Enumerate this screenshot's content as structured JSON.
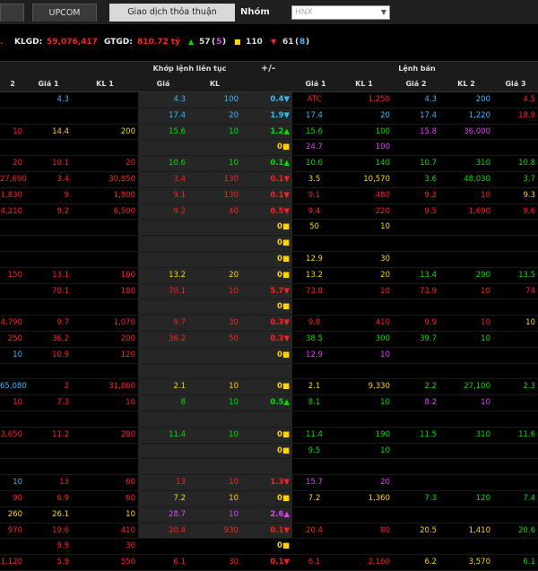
{
  "tabs": {
    "first": "",
    "upcom": "UPCOM",
    "thoathuan": "Giao dịch thỏa thuận"
  },
  "nhom_label": "Nhóm",
  "select_value": "HNX",
  "stats": {
    "klgd_label": "KLGD:",
    "klgd_value": "59,076,417",
    "gtgd_label": "GTGD:",
    "gtgd_value": "810.72 tỷ",
    "up_arrow": "▲",
    "up_count": "57",
    "up_ceil": "5",
    "ref_icon": "■",
    "ref_count": "110",
    "down_arrow": "▼",
    "down_count": "61",
    "down_floor": "8",
    "colors": {
      "up": "#00e000",
      "ref": "#ffd400",
      "down": "#ff2020",
      "ceil": "#e040fb",
      "floor": "#33bbff"
    }
  },
  "headers": {
    "match_group": "Khớp lệnh liên tục",
    "change": "+/-",
    "sell_group": "Lệnh bán",
    "cols": [
      "2",
      "Giá 1",
      "KL 1",
      "Giá",
      "KL",
      "",
      "Giá 1",
      "KL 1",
      "Giá 2",
      "KL 2",
      "Giá 3"
    ]
  },
  "rows": [
    [
      [
        "",
        ""
      ],
      [
        "4.3",
        "f"
      ],
      [
        "",
        ""
      ],
      [
        "4.3",
        "f"
      ],
      [
        "100",
        "f"
      ],
      [
        "0.4▼",
        "f"
      ],
      [
        "ATC",
        "d"
      ],
      [
        "1,250",
        "d"
      ],
      [
        "4.3",
        "f"
      ],
      [
        "200",
        "f"
      ],
      [
        "4.5",
        "d"
      ]
    ],
    [
      [
        "",
        ""
      ],
      [
        "",
        ""
      ],
      [
        "",
        ""
      ],
      [
        "17.4",
        "f"
      ],
      [
        "20",
        "f"
      ],
      [
        "1.9▼",
        "f"
      ],
      [
        "17.4",
        "f"
      ],
      [
        "20",
        "f"
      ],
      [
        "17.4",
        "f"
      ],
      [
        "1,220",
        "f"
      ],
      [
        "18.9",
        "d"
      ]
    ],
    [
      [
        "10",
        "d"
      ],
      [
        "14.4",
        "r"
      ],
      [
        "200",
        "r"
      ],
      [
        "15.6",
        "u"
      ],
      [
        "10",
        "u"
      ],
      [
        "1.2▲",
        "u"
      ],
      [
        "15.6",
        "u"
      ],
      [
        "100",
        "u"
      ],
      [
        "15.8",
        "c"
      ],
      [
        "36,000",
        "c"
      ],
      [
        "",
        ""
      ]
    ],
    [
      [
        "",
        ""
      ],
      [
        "",
        ""
      ],
      [
        "",
        ""
      ],
      [
        "",
        ""
      ],
      [
        "",
        ""
      ],
      [
        "0■",
        "r"
      ],
      [
        "24.7",
        "c"
      ],
      [
        "100",
        "c"
      ],
      [
        "",
        ""
      ],
      [
        "",
        ""
      ],
      [
        "",
        ""
      ]
    ],
    [
      [
        "20",
        "d"
      ],
      [
        "10.1",
        "d"
      ],
      [
        "20",
        "d"
      ],
      [
        "10.6",
        "u"
      ],
      [
        "10",
        "u"
      ],
      [
        "0.1▲",
        "u"
      ],
      [
        "10.6",
        "u"
      ],
      [
        "140",
        "u"
      ],
      [
        "10.7",
        "u"
      ],
      [
        "310",
        "u"
      ],
      [
        "10.8",
        "u"
      ]
    ],
    [
      [
        "27,690",
        "d"
      ],
      [
        "3.4",
        "d"
      ],
      [
        "30,850",
        "d"
      ],
      [
        "3.4",
        "d"
      ],
      [
        "130",
        "d"
      ],
      [
        "0.1▼",
        "d"
      ],
      [
        "3.5",
        "r"
      ],
      [
        "10,570",
        "r"
      ],
      [
        "3.6",
        "u"
      ],
      [
        "48,030",
        "u"
      ],
      [
        "3.7",
        "u"
      ]
    ],
    [
      [
        "1,830",
        "d"
      ],
      [
        "9",
        "d"
      ],
      [
        "1,800",
        "d"
      ],
      [
        "9.1",
        "d"
      ],
      [
        "130",
        "d"
      ],
      [
        "0.1▼",
        "d"
      ],
      [
        "9.1",
        "d"
      ],
      [
        "480",
        "d"
      ],
      [
        "9.2",
        "d"
      ],
      [
        "10",
        "d"
      ],
      [
        "9.3",
        "r"
      ]
    ],
    [
      [
        "4,210",
        "d"
      ],
      [
        "9.2",
        "d"
      ],
      [
        "6,500",
        "d"
      ],
      [
        "9.2",
        "d"
      ],
      [
        "40",
        "d"
      ],
      [
        "0.5▼",
        "d"
      ],
      [
        "9.4",
        "d"
      ],
      [
        "220",
        "d"
      ],
      [
        "9.5",
        "d"
      ],
      [
        "1,690",
        "d"
      ],
      [
        "9.6",
        "d"
      ]
    ],
    [
      [
        "",
        ""
      ],
      [
        "",
        ""
      ],
      [
        "",
        ""
      ],
      [
        "",
        ""
      ],
      [
        "",
        ""
      ],
      [
        "0■",
        "r"
      ],
      [
        "50",
        "r"
      ],
      [
        "10",
        "r"
      ],
      [
        "",
        ""
      ],
      [
        "",
        ""
      ],
      [
        "",
        ""
      ]
    ],
    [
      [
        "",
        ""
      ],
      [
        "",
        ""
      ],
      [
        "",
        ""
      ],
      [
        "",
        ""
      ],
      [
        "",
        ""
      ],
      [
        "0■",
        "r"
      ],
      [
        "",
        ""
      ],
      [
        "",
        ""
      ],
      [
        "",
        ""
      ],
      [
        "",
        ""
      ],
      [
        "",
        ""
      ]
    ],
    [
      [
        "",
        ""
      ],
      [
        "",
        ""
      ],
      [
        "",
        ""
      ],
      [
        "",
        ""
      ],
      [
        "",
        ""
      ],
      [
        "0■",
        "r"
      ],
      [
        "12.9",
        "r"
      ],
      [
        "30",
        "r"
      ],
      [
        "",
        ""
      ],
      [
        "",
        ""
      ],
      [
        "",
        ""
      ]
    ],
    [
      [
        "150",
        "d"
      ],
      [
        "13.1",
        "d"
      ],
      [
        "160",
        "d"
      ],
      [
        "13.2",
        "r"
      ],
      [
        "20",
        "r"
      ],
      [
        "0■",
        "r"
      ],
      [
        "13.2",
        "r"
      ],
      [
        "20",
        "r"
      ],
      [
        "13.4",
        "u"
      ],
      [
        "290",
        "u"
      ],
      [
        "13.5",
        "u"
      ]
    ],
    [
      [
        "",
        ""
      ],
      [
        "70.1",
        "d"
      ],
      [
        "180",
        "d"
      ],
      [
        "70.1",
        "d"
      ],
      [
        "10",
        "d"
      ],
      [
        "5.7▼",
        "d"
      ],
      [
        "73.8",
        "d"
      ],
      [
        "10",
        "d"
      ],
      [
        "73.9",
        "d"
      ],
      [
        "10",
        "d"
      ],
      [
        "74",
        "d"
      ]
    ],
    [
      [
        "",
        ""
      ],
      [
        "",
        ""
      ],
      [
        "",
        ""
      ],
      [
        "",
        ""
      ],
      [
        "",
        ""
      ],
      [
        "0■",
        "r"
      ],
      [
        "",
        ""
      ],
      [
        "",
        ""
      ],
      [
        "",
        ""
      ],
      [
        "",
        ""
      ],
      [
        "",
        ""
      ]
    ],
    [
      [
        "4,790",
        "d"
      ],
      [
        "9.7",
        "d"
      ],
      [
        "1,070",
        "d"
      ],
      [
        "9.7",
        "d"
      ],
      [
        "30",
        "d"
      ],
      [
        "0.3▼",
        "d"
      ],
      [
        "9.8",
        "d"
      ],
      [
        "410",
        "d"
      ],
      [
        "9.9",
        "d"
      ],
      [
        "10",
        "d"
      ],
      [
        "10",
        "r"
      ]
    ],
    [
      [
        "250",
        "d"
      ],
      [
        "36.2",
        "d"
      ],
      [
        "200",
        "d"
      ],
      [
        "36.2",
        "d"
      ],
      [
        "50",
        "d"
      ],
      [
        "0.3▼",
        "d"
      ],
      [
        "38.5",
        "u"
      ],
      [
        "300",
        "u"
      ],
      [
        "39.7",
        "u"
      ],
      [
        "10",
        "u"
      ],
      [
        "",
        ""
      ]
    ],
    [
      [
        "10",
        "f"
      ],
      [
        "10.9",
        "d"
      ],
      [
        "120",
        "d"
      ],
      [
        "",
        ""
      ],
      [
        "",
        ""
      ],
      [
        "0■",
        "r"
      ],
      [
        "12.9",
        "c"
      ],
      [
        "10",
        "c"
      ],
      [
        "",
        ""
      ],
      [
        "",
        ""
      ],
      [
        "",
        ""
      ]
    ],
    [
      [
        "",
        ""
      ],
      [
        "",
        ""
      ],
      [
        "",
        ""
      ],
      [
        "",
        ""
      ],
      [
        "",
        ""
      ],
      [
        "",
        ""
      ],
      [
        "",
        ""
      ],
      [
        "",
        ""
      ],
      [
        "",
        ""
      ],
      [
        "",
        ""
      ],
      [
        "",
        ""
      ]
    ],
    [
      [
        "65,080",
        "f"
      ],
      [
        "2",
        "d"
      ],
      [
        "31,860",
        "d"
      ],
      [
        "2.1",
        "r"
      ],
      [
        "10",
        "r"
      ],
      [
        "0■",
        "r"
      ],
      [
        "2.1",
        "r"
      ],
      [
        "9,330",
        "r"
      ],
      [
        "2.2",
        "u"
      ],
      [
        "27,100",
        "u"
      ],
      [
        "2.3",
        "u"
      ]
    ],
    [
      [
        "10",
        "d"
      ],
      [
        "7.3",
        "d"
      ],
      [
        "10",
        "d"
      ],
      [
        "8",
        "u"
      ],
      [
        "10",
        "u"
      ],
      [
        "0.5▲",
        "u"
      ],
      [
        "8.1",
        "u"
      ],
      [
        "10",
        "u"
      ],
      [
        "8.2",
        "c"
      ],
      [
        "10",
        "c"
      ],
      [
        "",
        ""
      ]
    ],
    [
      [
        "",
        ""
      ],
      [
        "",
        ""
      ],
      [
        "",
        ""
      ],
      [
        "",
        ""
      ],
      [
        "",
        ""
      ],
      [
        "",
        ""
      ],
      [
        "",
        ""
      ],
      [
        "",
        ""
      ],
      [
        "",
        ""
      ],
      [
        "",
        ""
      ],
      [
        "",
        ""
      ]
    ],
    [
      [
        "3,650",
        "d"
      ],
      [
        "11.2",
        "d"
      ],
      [
        "280",
        "d"
      ],
      [
        "11.4",
        "u"
      ],
      [
        "10",
        "u"
      ],
      [
        "0■",
        "r"
      ],
      [
        "11.4",
        "u"
      ],
      [
        "190",
        "u"
      ],
      [
        "11.5",
        "u"
      ],
      [
        "310",
        "u"
      ],
      [
        "11.6",
        "u"
      ]
    ],
    [
      [
        "",
        ""
      ],
      [
        "",
        ""
      ],
      [
        "",
        ""
      ],
      [
        "",
        ""
      ],
      [
        "",
        ""
      ],
      [
        "0■",
        "r"
      ],
      [
        "9.5",
        "u"
      ],
      [
        "10",
        "u"
      ],
      [
        "",
        ""
      ],
      [
        "",
        ""
      ],
      [
        "",
        ""
      ]
    ],
    [
      [
        "",
        ""
      ],
      [
        "",
        ""
      ],
      [
        "",
        ""
      ],
      [
        "",
        ""
      ],
      [
        "",
        ""
      ],
      [
        "",
        ""
      ],
      [
        "",
        ""
      ],
      [
        "",
        ""
      ],
      [
        "",
        ""
      ],
      [
        "",
        ""
      ],
      [
        "",
        ""
      ]
    ],
    [
      [
        "10",
        "f"
      ],
      [
        "13",
        "d"
      ],
      [
        "60",
        "d"
      ],
      [
        "13",
        "d"
      ],
      [
        "10",
        "d"
      ],
      [
        "1.3▼",
        "d"
      ],
      [
        "15.7",
        "c"
      ],
      [
        "20",
        "c"
      ],
      [
        "",
        ""
      ],
      [
        "",
        ""
      ],
      [
        "",
        ""
      ]
    ],
    [
      [
        "90",
        "d"
      ],
      [
        "6.9",
        "d"
      ],
      [
        "60",
        "d"
      ],
      [
        "7.2",
        "r"
      ],
      [
        "10",
        "r"
      ],
      [
        "0■",
        "r"
      ],
      [
        "7.2",
        "r"
      ],
      [
        "1,360",
        "r"
      ],
      [
        "7.3",
        "u"
      ],
      [
        "120",
        "u"
      ],
      [
        "7.4",
        "u"
      ]
    ],
    [
      [
        "260",
        "r"
      ],
      [
        "26.1",
        "r"
      ],
      [
        "10",
        "r"
      ],
      [
        "28.7",
        "c"
      ],
      [
        "10",
        "c"
      ],
      [
        "2.6▲",
        "c"
      ],
      [
        "",
        ""
      ],
      [
        "",
        ""
      ],
      [
        "",
        ""
      ],
      [
        "",
        ""
      ],
      [
        "",
        ""
      ]
    ],
    [
      [
        "970",
        "d"
      ],
      [
        "19.6",
        "d"
      ],
      [
        "410",
        "d"
      ],
      [
        "20.4",
        "d"
      ],
      [
        "930",
        "d"
      ],
      [
        "0.1▼",
        "d"
      ],
      [
        "20.4",
        "d"
      ],
      [
        "80",
        "d"
      ],
      [
        "20.5",
        "r"
      ],
      [
        "1,410",
        "r"
      ],
      [
        "20.6",
        "u"
      ]
    ],
    [
      [
        "",
        ""
      ],
      [
        "9.9",
        "d"
      ],
      [
        "30",
        "d"
      ],
      [
        "",
        ""
      ],
      [
        "",
        ""
      ],
      [
        "0■",
        "r"
      ],
      [
        "",
        ""
      ],
      [
        "",
        ""
      ],
      [
        "",
        ""
      ],
      [
        "",
        ""
      ],
      [
        "",
        ""
      ]
    ],
    [
      [
        "1,120",
        "d"
      ],
      [
        "5.9",
        "d"
      ],
      [
        "550",
        "d"
      ],
      [
        "6.1",
        "d"
      ],
      [
        "30",
        "d"
      ],
      [
        "0.1▼",
        "d"
      ],
      [
        "6.1",
        "d"
      ],
      [
        "2,160",
        "d"
      ],
      [
        "6.2",
        "r"
      ],
      [
        "3,570",
        "r"
      ],
      [
        "6.1",
        "u"
      ]
    ]
  ]
}
